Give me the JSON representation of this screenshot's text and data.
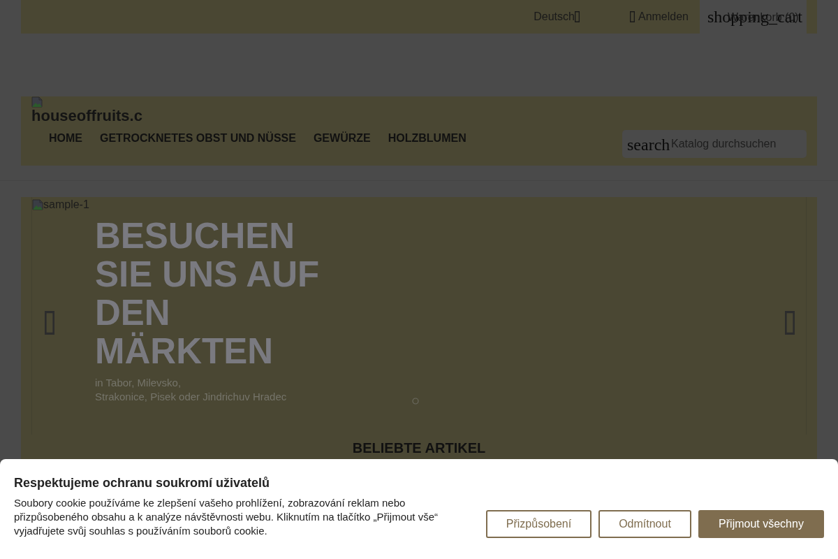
{
  "top_bar": {
    "language": "Deutsch",
    "sign_in": "Anmelden",
    "cart": {
      "icon_text": "shopping_cart",
      "label": "Warenkorb (0)"
    }
  },
  "header": {
    "logo_alt": "houseoffruits.c",
    "nav": [
      {
        "label": "HOME"
      },
      {
        "label": "GETROCKNETES OBST UND NÜSSE"
      },
      {
        "label": "GEWÜRZE"
      },
      {
        "label": "HOLZBLUMEN"
      }
    ],
    "search": {
      "icon_text": "search",
      "placeholder": "Katalog durchsuchen"
    }
  },
  "slider": {
    "image_alt": "sample-1",
    "title": "BESUCHEN SIE UNS AUF DEN MÄRKTEN",
    "subtitle_lines": [
      "in Tabor, Milevsko,",
      "Strakonice, Pisek oder Jindrichuv Hradec"
    ]
  },
  "featured": {
    "title": "BELIEBTE ARTIKEL"
  },
  "cookie_banner": {
    "title": "Respektujeme ochranu soukromí uživatelů",
    "text": "Soubory cookie používáme ke zlepšení vašeho prohlížení, zobrazování reklam nebo přizpůsobeného obsahu a k analýze návštěvnosti webu. Kliknutím na tlačítko „Přijmout vše“ vyjadřujete svůj souhlas s používáním souborů cookie.",
    "buttons": [
      {
        "label": "Přizpůsobení",
        "kind": "outline"
      },
      {
        "label": "Odmítnout",
        "kind": "outline"
      },
      {
        "label": "Přijmout všechny",
        "kind": "primary"
      }
    ]
  }
}
